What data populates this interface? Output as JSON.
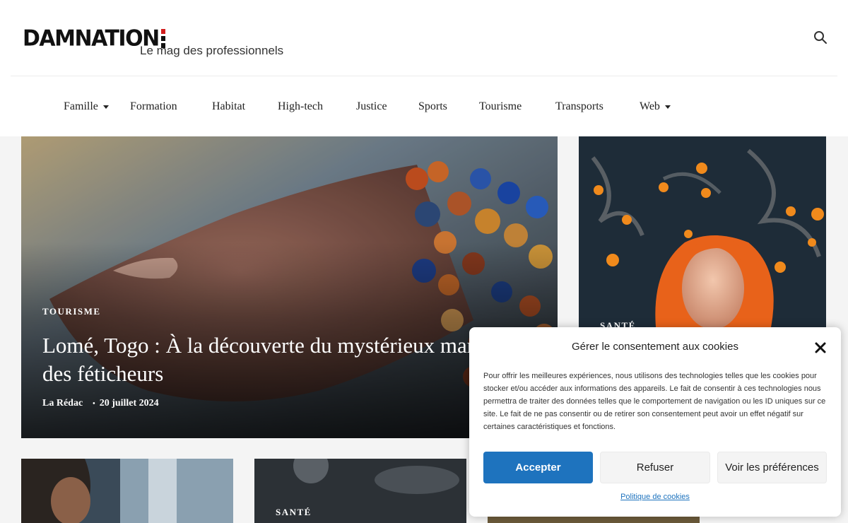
{
  "header": {
    "logo_text": "DAMNATION",
    "tagline": "Le mag des professionnels"
  },
  "nav": {
    "items": [
      {
        "label": "Famille",
        "has_dropdown": true
      },
      {
        "label": "Formation",
        "has_dropdown": false
      },
      {
        "label": "Habitat",
        "has_dropdown": false
      },
      {
        "label": "High-tech",
        "has_dropdown": false
      },
      {
        "label": "Justice",
        "has_dropdown": false
      },
      {
        "label": "Sports",
        "has_dropdown": false
      },
      {
        "label": "Tourisme",
        "has_dropdown": false
      },
      {
        "label": "Transports",
        "has_dropdown": false
      },
      {
        "label": "Web",
        "has_dropdown": true
      }
    ]
  },
  "hero": {
    "category": "TOURISME",
    "title": "Lomé, Togo : À la découverte du mystérieux marché des féticheurs",
    "author": "La Rédac",
    "date": "20 juillet 2024"
  },
  "side": {
    "category": "SANTÉ"
  },
  "cards": [
    {
      "category": ""
    },
    {
      "category": "SANTÉ"
    },
    {
      "category": ""
    }
  ],
  "cookie": {
    "title": "Gérer le consentement aux cookies",
    "text": "Pour offrir les meilleures expériences, nous utilisons des technologies telles que les cookies pour stocker et/ou accéder aux informations des appareils. Le fait de consentir à ces technologies nous permettra de traiter des données telles que le comportement de navigation ou les ID uniques sur ce site. Le fait de ne pas consentir ou de retirer son consentement peut avoir un effet négatif sur certaines caractéristiques et fonctions.",
    "accept": "Accepter",
    "refuse": "Refuser",
    "preferences": "Voir les préférences",
    "policy_link": "Politique de cookies"
  },
  "colors": {
    "accent": "#1e73be",
    "logo_red": "#d21d1d"
  }
}
